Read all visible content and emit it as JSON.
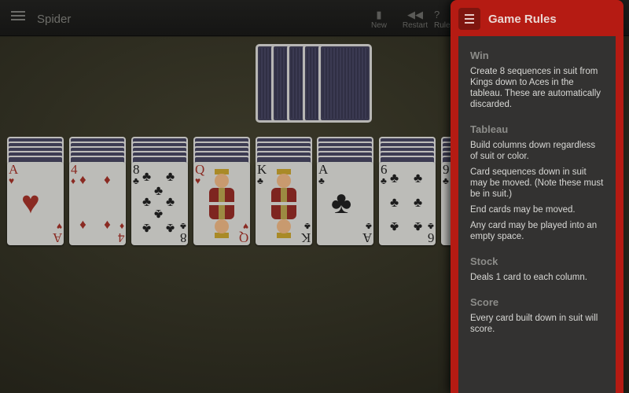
{
  "app": {
    "title": "Spider"
  },
  "toolbar": {
    "new_label": "New",
    "restart_label": "Restart",
    "rules_label": "Rules"
  },
  "rules": {
    "title": "Game Rules",
    "sections": [
      {
        "heading": "Win",
        "paragraphs": [
          "Create 8 sequences in suit from Kings down to Aces in the tableau. These are automatically discarded."
        ]
      },
      {
        "heading": "Tableau",
        "paragraphs": [
          "Build columns down regardless of suit or color.",
          "Card sequences down in suit may be moved. (Note these must be in suit.)",
          "End cards may be moved.",
          "Any card may be played into an empty space."
        ]
      },
      {
        "heading": "Stock",
        "paragraphs": [
          "Deals 1 card to each column."
        ]
      },
      {
        "heading": "Score",
        "paragraphs": [
          "Every card built down in suit will score."
        ]
      }
    ]
  },
  "tableau": {
    "columns": [
      {
        "rank": "A",
        "suit": "♥",
        "color": "red"
      },
      {
        "rank": "4",
        "suit": "♦",
        "color": "red"
      },
      {
        "rank": "8",
        "suit": "♣",
        "color": "black"
      },
      {
        "rank": "Q",
        "suit": "♥",
        "color": "red"
      },
      {
        "rank": "K",
        "suit": "♣",
        "color": "black"
      },
      {
        "rank": "A",
        "suit": "♣",
        "color": "black"
      },
      {
        "rank": "6",
        "suit": "♣",
        "color": "black"
      },
      {
        "rank": "9",
        "suit": "♣",
        "color": "black"
      }
    ]
  },
  "stock": {
    "piles": 5
  },
  "colors": {
    "accent": "#b51b13",
    "felt": "#2c2b1f"
  },
  "icons": {
    "menu": "hamburger-menu-icon",
    "new": "new-game-icon",
    "restart": "restart-icon",
    "rules": "rules-icon"
  }
}
